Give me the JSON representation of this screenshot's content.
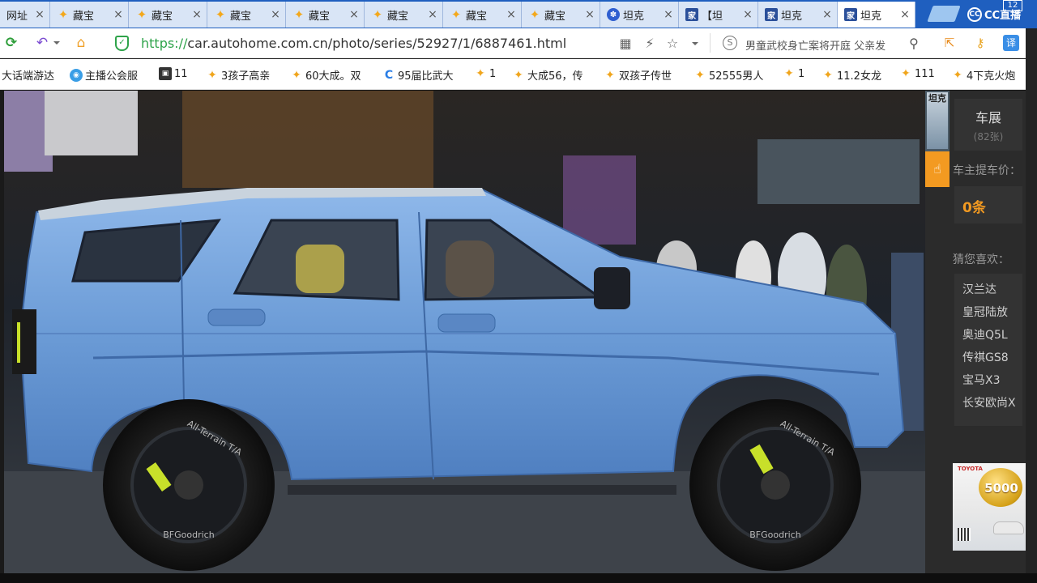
{
  "tabs": [
    {
      "label": "网址",
      "icon": "none",
      "active": false
    },
    {
      "label": "藏宝",
      "icon": "star",
      "active": false
    },
    {
      "label": "藏宝",
      "icon": "star",
      "active": false
    },
    {
      "label": "藏宝",
      "icon": "star",
      "active": false
    },
    {
      "label": "藏宝",
      "icon": "star",
      "active": false
    },
    {
      "label": "藏宝",
      "icon": "star",
      "active": false
    },
    {
      "label": "藏宝",
      "icon": "star",
      "active": false
    },
    {
      "label": "藏宝",
      "icon": "star",
      "active": false
    },
    {
      "label": "坦克",
      "icon": "paw",
      "active": false
    },
    {
      "label": "【坦",
      "icon": "home",
      "active": false
    },
    {
      "label": "坦克",
      "icon": "home",
      "active": false
    },
    {
      "label": "坦克",
      "icon": "home",
      "active": true
    }
  ],
  "browser": {
    "brand_label": "CC直播",
    "clock_badge": "12",
    "url_protocol": "https://",
    "url_rest": "car.autohome.com.cn/photo/series/52927/1/6887461.html",
    "news_ticker": "男童武校身亡案将开庭 父亲发",
    "icons": {
      "refresh": "refresh-icon",
      "undo": "undo-icon",
      "home": "home-icon",
      "security": "shield-icon",
      "grid": "grid-icon",
      "bolt": "bolt-icon",
      "favorite": "star-icon",
      "search_engine": "s-icon",
      "search": "search-icon",
      "share": "share-icon",
      "key": "key-icon",
      "translate": "translate-icon"
    },
    "glyphs": {
      "close": "×",
      "refresh": "⟳",
      "undo": "↶",
      "home": "⌂",
      "shield": "✓",
      "grid": "▦",
      "bolt": "⚡",
      "star": "☆",
      "s": "S",
      "search": "⚲",
      "share": "⇱",
      "key": "⚷",
      "translate": "译",
      "paw": "✽",
      "homefav": "家",
      "bm_star": "✦",
      "bm_circle": "◉",
      "bm_swirl": "C",
      "bm_square": "▣",
      "hand": "☝"
    }
  },
  "bookmarks": [
    {
      "label": "大话端游达",
      "icon": "none"
    },
    {
      "label": "主播公会服",
      "icon": "circle"
    },
    {
      "label": "11",
      "icon": "square"
    },
    {
      "label": "3孩子高亲",
      "icon": "star"
    },
    {
      "label": "60大成。双",
      "icon": "star"
    },
    {
      "label": "95届比武大",
      "icon": "swirl"
    },
    {
      "label": "1",
      "icon": "star"
    },
    {
      "label": "大成56，传",
      "icon": "star"
    },
    {
      "label": "双孩子传世",
      "icon": "star"
    },
    {
      "label": "52555男人",
      "icon": "star"
    },
    {
      "label": "1",
      "icon": "star"
    },
    {
      "label": "11.2女龙",
      "icon": "star"
    },
    {
      "label": "111",
      "icon": "star"
    },
    {
      "label": "4下克火炮",
      "icon": "star"
    }
  ],
  "photo": {
    "wheel_brand": "BFGoodrich",
    "tire_model": "All-Terrain T/A",
    "colors": {
      "body": "#6f9fd8",
      "body_dark": "#4f7fbf",
      "body_light": "#9cc3ee",
      "tire": "#1c1c1c",
      "accent": "#c8e02a"
    }
  },
  "sidepanel": {
    "thumb_label": "坦克",
    "expo_title": "车展",
    "expo_count": "(82张)",
    "price_label": "车主提车价：",
    "price_count": "0条",
    "guess_label": "猜您喜欢：",
    "guess_items": [
      "汉兰达",
      "皇冠陆放",
      "奥迪Q5L",
      "传祺GS8",
      "宝马X3",
      "长安欧尚X"
    ],
    "ad_amount": "5000",
    "colors": {
      "accent": "#f39a21",
      "panel": "#2b2b2b",
      "tile": "#333333"
    }
  }
}
